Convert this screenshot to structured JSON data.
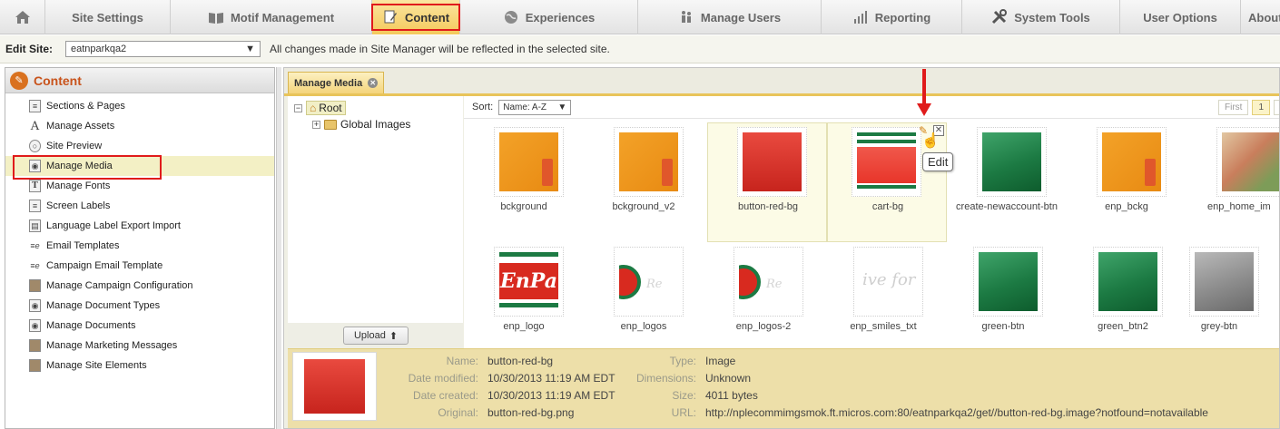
{
  "nav": {
    "tabs": [
      {
        "label": "",
        "icon": "home-icon"
      },
      {
        "label": "Site Settings",
        "icon": ""
      },
      {
        "label": "Motif Management",
        "icon": "book-icon"
      },
      {
        "label": "Content",
        "icon": "edit-document-icon",
        "active": true
      },
      {
        "label": "Experiences",
        "icon": "globe-icon"
      },
      {
        "label": "Manage Users",
        "icon": "users-icon"
      },
      {
        "label": "Reporting",
        "icon": "bar-chart-icon"
      },
      {
        "label": "System Tools",
        "icon": "tools-icon"
      },
      {
        "label": "User Options",
        "icon": ""
      },
      {
        "label": "About",
        "icon": ""
      }
    ]
  },
  "site_bar": {
    "label": "Edit Site:",
    "selected_site": "eatnparkqa2",
    "message": "All changes made in Site Manager will be reflected in the selected site."
  },
  "left_panel": {
    "title": "Content",
    "items": [
      {
        "label": "Sections & Pages",
        "icon": "page-icon"
      },
      {
        "label": "Manage Assets",
        "icon": "assets-icon"
      },
      {
        "label": "Site Preview",
        "icon": "magnifier-icon"
      },
      {
        "label": "Manage Media",
        "icon": "media-icon",
        "active": true
      },
      {
        "label": "Manage Fonts",
        "icon": "font-icon"
      },
      {
        "label": "Screen Labels",
        "icon": "page-icon"
      },
      {
        "label": "Language Label Export Import",
        "icon": "export-icon"
      },
      {
        "label": "Email Templates",
        "icon": "email-icon"
      },
      {
        "label": "Campaign Email Template",
        "icon": "email-icon"
      },
      {
        "label": "Manage Campaign Configuration",
        "icon": "cabinet-icon"
      },
      {
        "label": "Manage Document Types",
        "icon": "media-icon"
      },
      {
        "label": "Manage Documents",
        "icon": "media-icon"
      },
      {
        "label": "Manage Marketing Messages",
        "icon": "cabinet-icon"
      },
      {
        "label": "Manage Site Elements",
        "icon": "cabinet-icon"
      }
    ]
  },
  "media": {
    "tab_label": "Manage Media",
    "tree": {
      "root_label": "Root",
      "child_label": "Global Images"
    },
    "upload_label": "Upload",
    "sort": {
      "label": "Sort:",
      "selected": "Name: A-Z"
    },
    "pager": {
      "first": "First",
      "current": "1"
    },
    "tiles": [
      {
        "name": "bckground",
        "kind": "orange"
      },
      {
        "name": "bckground_v2",
        "kind": "orange"
      },
      {
        "name": "button-red-bg",
        "kind": "red",
        "selected": true
      },
      {
        "name": "cart-bg",
        "kind": "cart",
        "hover": true
      },
      {
        "name": "create-newaccount-btn",
        "kind": "green"
      },
      {
        "name": "enp_bckg",
        "kind": "orange"
      },
      {
        "name": "enp_home_im",
        "kind": "food"
      },
      {
        "name": "enp_logo",
        "kind": "logo"
      },
      {
        "name": "enp_logos",
        "kind": "logos"
      },
      {
        "name": "enp_logos-2",
        "kind": "logos"
      },
      {
        "name": "enp_smiles_txt",
        "kind": "smiles"
      },
      {
        "name": "green-btn",
        "kind": "green"
      },
      {
        "name": "green_btn2",
        "kind": "green"
      },
      {
        "name": "grey-btn",
        "kind": "grey"
      }
    ],
    "logo_text": "EnPa",
    "logos_script": "Re",
    "smiles_script": "ive for",
    "tooltip": "Edit"
  },
  "details": {
    "name_label": "Name:",
    "name": "button-red-bg",
    "modified_label": "Date modified:",
    "modified": "10/30/2013 11:19 AM EDT",
    "created_label": "Date created:",
    "created": "10/30/2013 11:19 AM EDT",
    "original_label": "Original:",
    "original": "button-red-bg.png",
    "type_label": "Type:",
    "type": "Image",
    "dimensions_label": "Dimensions:",
    "dimensions": "Unknown",
    "size_label": "Size:",
    "size": "4011 bytes",
    "url_label": "URL:",
    "url": "http://nplecommimgsmok.ft.micros.com:80/eatnparkqa2/get//button-red-bg.image?notfound=notavailable"
  },
  "colors": {
    "accent_red": "#e01b1b",
    "tab_gold": "#f4c95b",
    "content_orange": "#c8531b"
  }
}
